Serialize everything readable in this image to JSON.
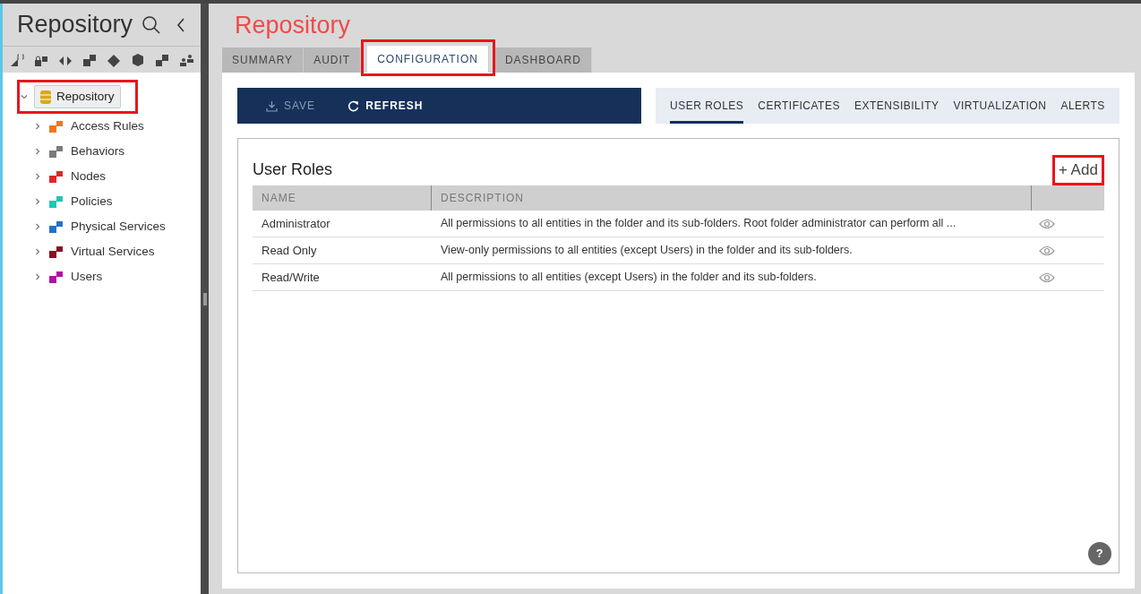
{
  "sidebar": {
    "title": "Repository",
    "tree": {
      "label": "Repository",
      "expanded": true,
      "highlighted": true,
      "children": [
        {
          "label": "Access Rules",
          "expanded": false,
          "color": "#f5761a"
        },
        {
          "label": "Behaviors",
          "expanded": false,
          "color": "#7a7a7a"
        },
        {
          "label": "Nodes",
          "expanded": false,
          "color": "#e0262b"
        },
        {
          "label": "Policies",
          "expanded": false,
          "color": "#1fc6b8"
        },
        {
          "label": "Physical Services",
          "expanded": false,
          "color": "#2472c8"
        },
        {
          "label": "Virtual Services",
          "expanded": false,
          "color": "#8b1020"
        },
        {
          "label": "Users",
          "expanded": false,
          "color": "#b0139e"
        }
      ]
    }
  },
  "main": {
    "title": "Repository",
    "tabs": [
      {
        "label": "SUMMARY",
        "selected": false,
        "highlighted": false
      },
      {
        "label": "AUDIT",
        "selected": false,
        "highlighted": false
      },
      {
        "label": "CONFIGURATION",
        "selected": true,
        "highlighted": true
      },
      {
        "label": "DASHBOARD",
        "selected": false,
        "highlighted": false
      }
    ],
    "toolbar": [
      {
        "label": "SAVE",
        "disabled": true,
        "kind": "save"
      },
      {
        "label": "REFRESH",
        "disabled": false,
        "kind": "refresh"
      }
    ],
    "subtabs": [
      {
        "label": "USER ROLES",
        "selected": true
      },
      {
        "label": "CERTIFICATES",
        "selected": false
      },
      {
        "label": "EXTENSIBILITY",
        "selected": false
      },
      {
        "label": "VIRTUALIZATION",
        "selected": false
      },
      {
        "label": "ALERTS",
        "selected": false
      }
    ],
    "panel": {
      "title": "User Roles",
      "add": {
        "label": "+ Add",
        "highlighted": true
      },
      "table": {
        "columns": [
          "NAME",
          "DESCRIPTION"
        ],
        "rows": [
          {
            "name": "Administrator",
            "description": "All permissions to all entities in the folder and its sub-folders. Root folder administrator can perform all ..."
          },
          {
            "name": "Read Only",
            "description": "View-only permissions to all entities (except Users) in the folder and its sub-folders."
          },
          {
            "name": "Read/Write",
            "description": "All permissions to all entities (except Users) in the folder and its sub-folders."
          }
        ]
      }
    },
    "help": "?"
  }
}
